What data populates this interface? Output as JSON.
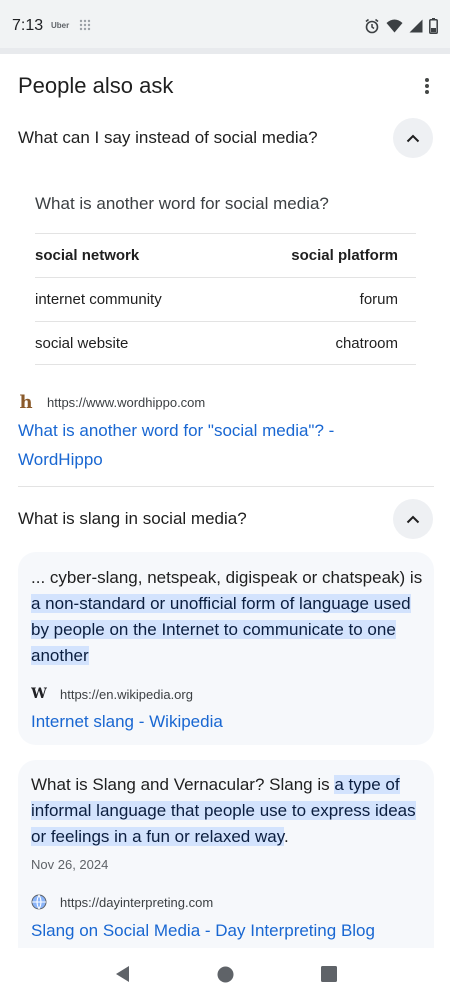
{
  "status_bar": {
    "time": "7:13",
    "app_label": "Uber"
  },
  "section": {
    "title": "People also ask"
  },
  "q1": {
    "question": "What can I say instead of social media?",
    "subheading": "What is another word for social media?",
    "synonyms": [
      [
        "social network",
        "social platform"
      ],
      [
        "internet community",
        "forum"
      ],
      [
        "social website",
        "chatroom"
      ]
    ],
    "source_url": "https://www.wordhippo.com",
    "link_line1": "What is another word for \"social media\"? -",
    "link_line2": "WordHippo"
  },
  "q2": {
    "question": "What is slang in social media?",
    "card1": {
      "text_pre": "... cyber-slang, netspeak, digispeak or chatspeak) is ",
      "highlight": "a non-standard or unofficial form of language used by people on the Internet to communicate to one another",
      "source_url": "https://en.wikipedia.org",
      "link": "Internet slang - Wikipedia"
    },
    "card2": {
      "text_pre": "What is Slang and Vernacular? Slang is ",
      "highlight": "a type of informal language that people use to express ideas or feelings in a fun or relaxed way",
      "text_post": ".",
      "date": "Nov 26, 2024",
      "source_url": "https://dayinterpreting.com",
      "link": "Slang on Social Media - Day Interpreting Blog"
    }
  },
  "icons": {
    "wordhippo": "h",
    "wikipedia": "W"
  },
  "colors": {
    "link": "#1967d2",
    "highlight": "#d3e3fd",
    "card_bg": "#f6f8fb"
  }
}
